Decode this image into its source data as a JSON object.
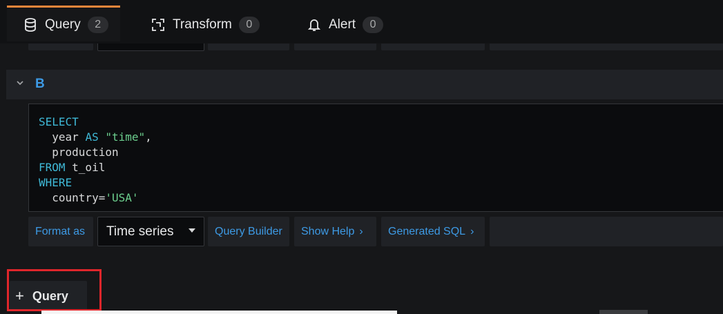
{
  "tabs": [
    {
      "label": "Query",
      "count": "2",
      "icon": "database-icon",
      "active": true
    },
    {
      "label": "Transform",
      "count": "0",
      "icon": "transform-icon",
      "active": false
    },
    {
      "label": "Alert",
      "count": "0",
      "icon": "bell-icon",
      "active": false
    }
  ],
  "query": {
    "name": "B",
    "sql_lines": [
      "SELECT",
      "  year AS \"time\",",
      "  production",
      "FROM t_oil",
      "WHERE",
      "  country='USA'"
    ]
  },
  "toolbar": {
    "format_label": "Format as",
    "format_value": "Time series",
    "query_builder_label": "Query Builder",
    "show_help_label": "Show Help",
    "generated_sql_label": "Generated SQL",
    "chevron": "›"
  },
  "add_query": {
    "label": "Query",
    "icon": "plus-icon"
  },
  "colors": {
    "accent": "#3d9ae5",
    "active_tab": "#f4863b",
    "highlight": "#e0262b"
  }
}
